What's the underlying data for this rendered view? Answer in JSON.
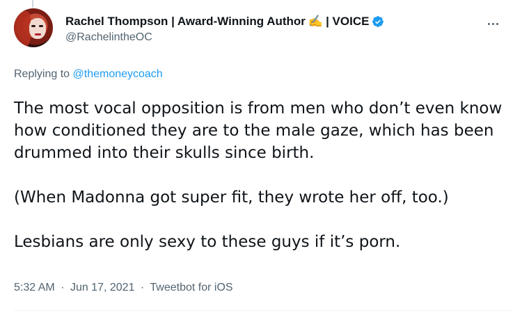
{
  "author": {
    "display_name": "Rachel Thompson | Award-Winning Author",
    "pen_emoji": "✍️",
    "name_suffix": "| VOICE",
    "handle": "@RachelintheOC",
    "verified": true
  },
  "reply": {
    "prefix": "Replying to",
    "mention": "@themoneycoach"
  },
  "tweet": {
    "paragraphs": [
      "The most vocal opposition is from men who don’t even know how conditioned they are to the male gaze, which has been drummed into their skulls since birth.",
      "(When Madonna got super fit, they wrote her off, too.)",
      "Lesbians are only sexy to these guys if it’s porn."
    ]
  },
  "meta": {
    "time": "5:32 AM",
    "date": "Jun 17, 2021",
    "source": "Tweetbot for iOS",
    "separator": "·"
  },
  "icons": {
    "more": "more-horizontal-icon",
    "verified": "verified-badge-icon"
  },
  "colors": {
    "accent": "#1d9bf0",
    "secondary_text": "#536471",
    "primary_text": "#0f1419"
  }
}
